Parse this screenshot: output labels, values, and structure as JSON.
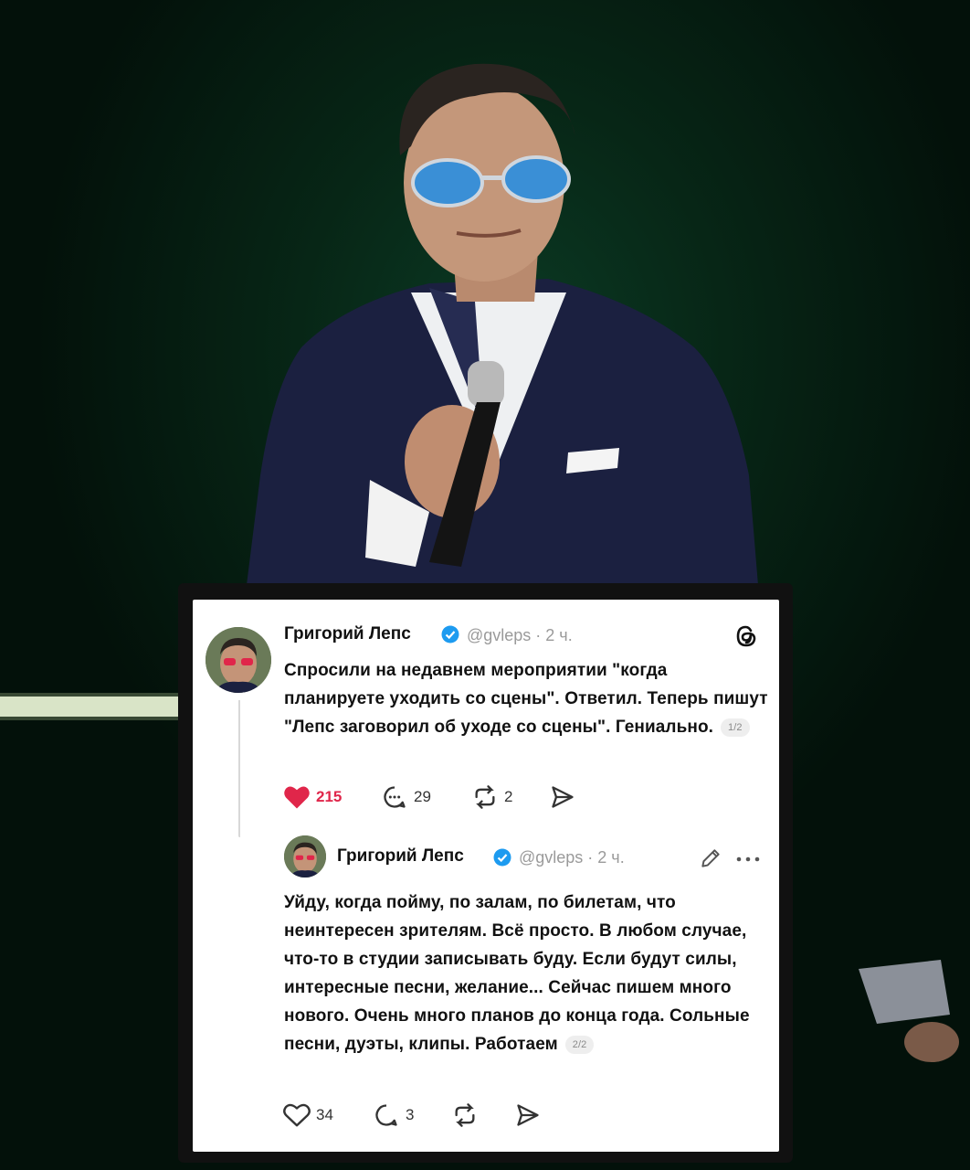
{
  "post1": {
    "author": "Григорий Лепс",
    "handle": "@gvleps · 2 ч.",
    "text": "Спросили на недавнем мероприятии \"когда планируете уходить со сцены\". Ответил. Теперь пишут \"Лепс заговорил об уходе со сцены\". Гениально.",
    "pager": "1/2",
    "likes": "215",
    "replies": "29",
    "reposts": "2",
    "liked": true
  },
  "post2": {
    "author": "Григорий Лепс",
    "handle": "@gvleps · 2 ч.",
    "text": "Уйду, когда пойму, по залам, по билетам, что неинтересен зрителям. Всё просто. В любом случае, что-то в студии записывать буду. Если будут силы, интересные песни, желание... Сейчас пишем много нового. Очень много планов до конца года. Сольные песни, дуэты, клипы. Работаем",
    "pager": "2/2",
    "likes": "34",
    "replies": "3"
  },
  "colors": {
    "like": "#e0264a",
    "verified": "#1d9bf0",
    "background": "#072616"
  },
  "icons": [
    "threads-logo-icon",
    "verified-icon",
    "heart-icon",
    "comment-icon",
    "repost-icon",
    "share-icon",
    "edit-icon",
    "more-icon"
  ]
}
